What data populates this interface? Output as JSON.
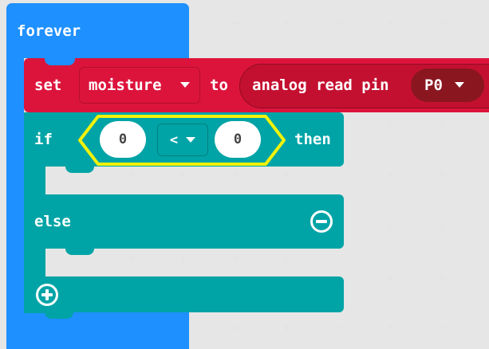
{
  "forever": {
    "label": "forever"
  },
  "set_block": {
    "set_label": "set",
    "variable": "moisture",
    "to_label": "to",
    "reporter_label": "analog read pin",
    "pin": "P0"
  },
  "if_block": {
    "if_label": "if",
    "left_value": "0",
    "operator": "<",
    "right_value": "0",
    "then_label": "then",
    "else_label": "else"
  },
  "colors": {
    "loops": "#1e90ff",
    "variables": "#dc143c",
    "logic": "#00a4a6",
    "condition_highlight": "#f2f20a"
  },
  "icons": [
    "remove-else-icon",
    "add-else-icon",
    "dropdown-caret-icon"
  ]
}
